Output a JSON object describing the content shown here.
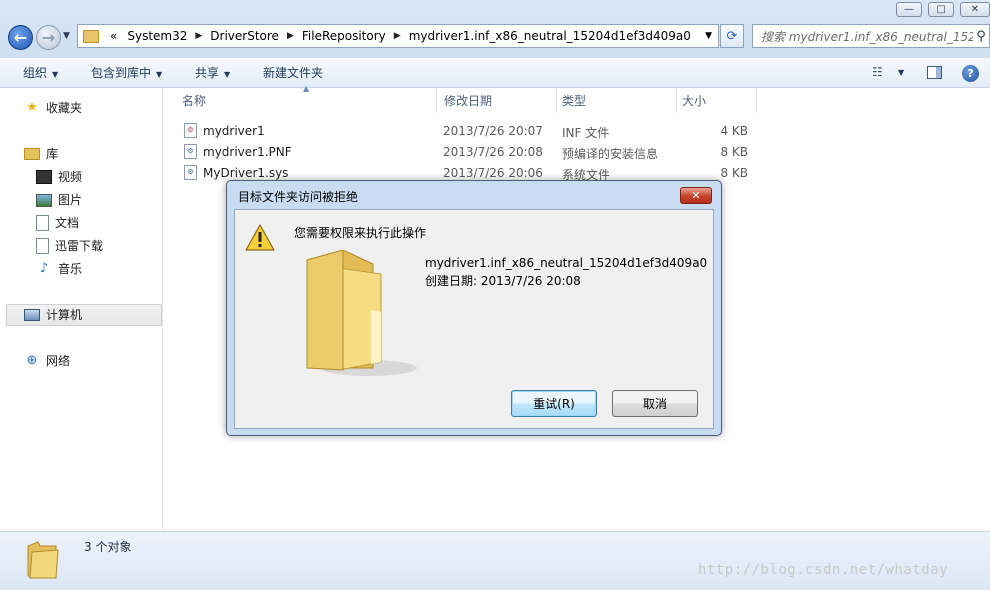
{
  "window": {
    "minimize_glyph": "—",
    "maximize_glyph": "□",
    "close_glyph": "✕"
  },
  "address": {
    "overflow": "«",
    "crumbs": [
      "System32",
      "DriverStore",
      "FileRepository",
      "mydriver1.inf_x86_neutral_15204d1ef3d409a0"
    ],
    "separator": "▶"
  },
  "search": {
    "placeholder": "搜索 mydriver1.inf_x86_neutral_152..."
  },
  "toolbar": {
    "organize": "组织",
    "include": "包含到库中",
    "share": "共享",
    "new_folder": "新建文件夹"
  },
  "nav": {
    "favorites": "收藏夹",
    "libraries": "库",
    "videos": "视频",
    "pictures": "图片",
    "documents": "文档",
    "xunlei": "迅雷下载",
    "music": "音乐",
    "computer": "计算机",
    "network": "网络"
  },
  "columns": {
    "name": "名称",
    "date": "修改日期",
    "type": "类型",
    "size": "大小"
  },
  "files": [
    {
      "name": "mydriver1",
      "date": "2013/7/26 20:07",
      "type": "INF 文件",
      "size": "4 KB"
    },
    {
      "name": "mydriver1.PNF",
      "date": "2013/7/26 20:08",
      "type": "预编译的安装信息",
      "size": "8 KB"
    },
    {
      "name": "MyDriver1.sys",
      "date": "2013/7/26 20:06",
      "type": "系统文件",
      "size": "8 KB"
    }
  ],
  "status": {
    "count": "3 个对象",
    "watermark": "http://blog.csdn.net/whatday"
  },
  "dialog": {
    "title": "目标文件夹访问被拒绝",
    "message": "您需要权限来执行此操作",
    "filename": "mydriver1.inf_x86_neutral_15204d1ef3d409a0",
    "created": "创建日期: 2013/7/26 20:08",
    "retry": "重试(R)",
    "cancel": "取消"
  },
  "colors": {
    "chrome": "#cfdff0",
    "dialog_frame": "#c8dcf1",
    "close_red": "#c5432c",
    "accent": "#1e395b"
  }
}
